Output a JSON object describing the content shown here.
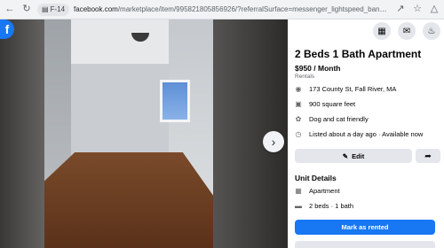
{
  "browser": {
    "tab_label": "F-14",
    "url_domain": "facebook.com",
    "url_path": "/marketplace/item/995821805856926/?referralSurface=messenger_lightspeed_banner&referralCode=messeng..."
  },
  "listing": {
    "title": "2 Beds 1 Bath Apartment",
    "price": "$950 / Month",
    "category": "Rentals",
    "info": [
      {
        "icon": "map-pin-icon",
        "text": "173 County St, Fall River, MA"
      },
      {
        "icon": "ruler-icon",
        "text": "900 square feet"
      },
      {
        "icon": "paw-icon",
        "text": "Dog and cat friendly"
      },
      {
        "icon": "clock-icon",
        "text": "Listed about a day ago · Available now"
      }
    ],
    "edit_label": "Edit",
    "unit_details_title": "Unit Details",
    "unit_details": [
      {
        "icon": "building-icon",
        "text": "Apartment"
      },
      {
        "icon": "bed-icon",
        "text": "2 beds · 1 bath"
      }
    ],
    "mark_rented_label": "Mark as rented"
  },
  "colors": {
    "brand": "#1877f2",
    "button_gray": "#e4e6eb",
    "muted_text": "#65676b"
  }
}
